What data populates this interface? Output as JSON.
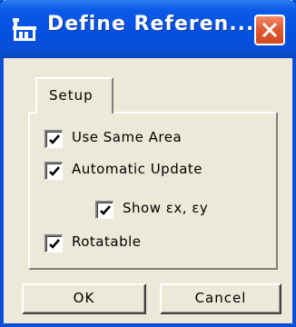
{
  "window": {
    "title": "Define Referen...",
    "close_icon": "close-icon"
  },
  "tabs": [
    {
      "label": "Setup",
      "selected": true
    }
  ],
  "options": {
    "use_same_area": {
      "label": "Use Same Area",
      "checked": true
    },
    "automatic_update": {
      "label": "Automatic Update",
      "checked": true
    },
    "show_ex_ey": {
      "label": "Show εx, εy",
      "checked": true
    },
    "rotatable": {
      "label": "Rotatable",
      "checked": true
    }
  },
  "buttons": {
    "ok": "OK",
    "cancel": "Cancel"
  },
  "colors": {
    "titlebar": "#0a4fd6",
    "close_button": "#e25a31",
    "face": "#ece9d8"
  }
}
